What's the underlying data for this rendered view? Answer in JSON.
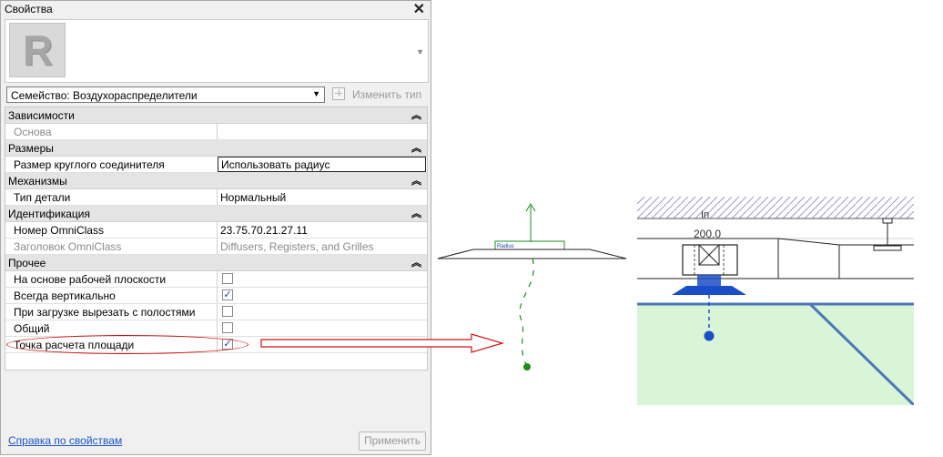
{
  "window": {
    "title": "Свойства"
  },
  "preview": {
    "logo_letter": "R"
  },
  "family_selector": {
    "value": "Семейство: Воздухораспределители",
    "edit_type_label": "Изменить тип"
  },
  "groups": [
    {
      "label": "Зависимости",
      "rows": [
        {
          "name": "Основа",
          "value": "",
          "greyed": true
        }
      ]
    },
    {
      "label": "Размеры",
      "rows": [
        {
          "name": "Размер круглого соединителя",
          "value": "Использовать радиус",
          "editing": true
        }
      ]
    },
    {
      "label": "Механизмы",
      "rows": [
        {
          "name": "Тип детали",
          "value": "Нормальный"
        }
      ]
    },
    {
      "label": "Идентификация",
      "rows": [
        {
          "name": "Номер OmniClass",
          "value": "23.75.70.21.27.11"
        },
        {
          "name": "Заголовок OmniClass",
          "value": "Diffusers, Registers, and Grilles",
          "greyed": true
        }
      ]
    },
    {
      "label": "Прочее",
      "rows": [
        {
          "name": "На основе рабочей плоскости",
          "checked": false
        },
        {
          "name": "Всегда вертикально",
          "checked": true
        },
        {
          "name": "При загрузке вырезать с полостями",
          "checked": false
        },
        {
          "name": "Общий",
          "checked": false
        },
        {
          "name": "Точка расчета площади",
          "checked": true,
          "highlighted": true
        }
      ]
    }
  ],
  "footer": {
    "help_link": "Справка по свойствам",
    "apply_button": "Применить"
  },
  "side_view": {
    "label": "Radius",
    "color": "#1a8f1a"
  },
  "plan_view": {
    "room_label": "In",
    "size_label": "200.0",
    "room_fill": "#d8f5d8",
    "duct_blue": "#1a4ec8"
  },
  "colors": {
    "highlight_red": "#d01010"
  }
}
